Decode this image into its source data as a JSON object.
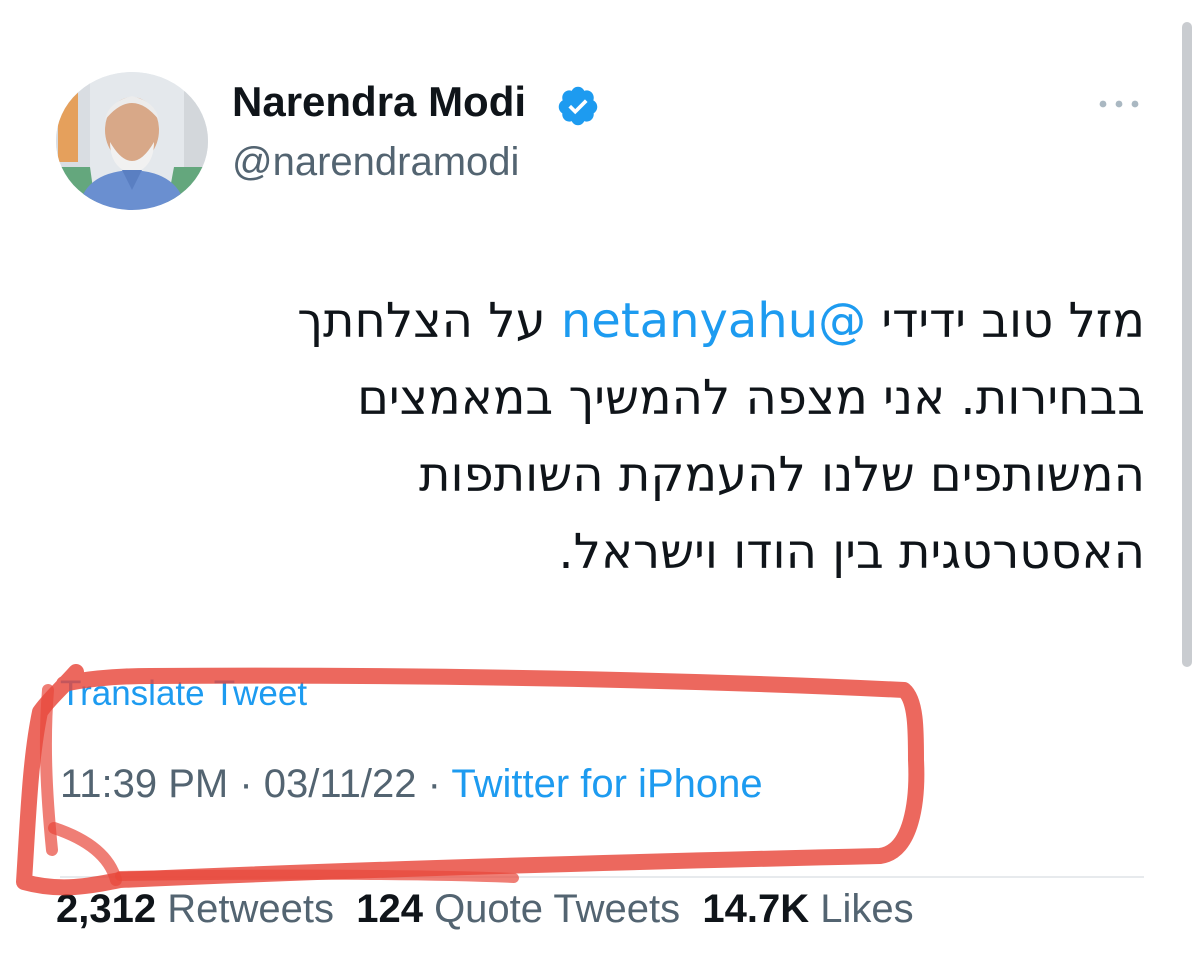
{
  "author": {
    "display_name": "Narendra Modi",
    "handle": "@narendramodi"
  },
  "tweet": {
    "text_before": "מזל טוב ידידי ",
    "mention": "@netanyahu",
    "text_after": " על הצלחתך בבחירות. אני מצפה להמשיך במאמצים המשותפים שלנו להעמקת השותפות האסטרטגית בין הודו וישראל."
  },
  "translate_label": "Translate Tweet",
  "meta": {
    "time": "11:39 PM",
    "separator_1": " · ",
    "date": "03/11/22",
    "separator_2": " · ",
    "source": "Twitter for iPhone"
  },
  "stats": {
    "retweets_count": "2,312",
    "retweets_label": " Retweets",
    "quotes_count": "124",
    "quotes_label": " Quote Tweets",
    "likes_count": "14.7K",
    "likes_label": " Likes"
  },
  "colors": {
    "accent": "#1d9bf0",
    "annotation": "#e8473b",
    "secondary_text": "#536471"
  },
  "icons": {
    "verified": "verified-badge-icon",
    "more": "more-options-icon"
  }
}
